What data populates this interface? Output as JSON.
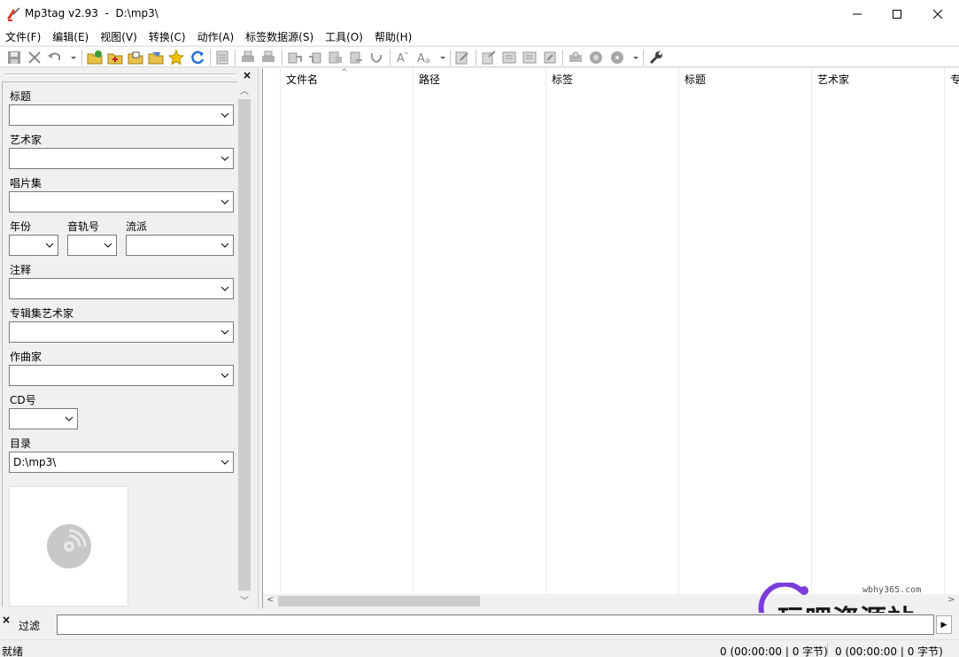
{
  "window": {
    "title": "Mp3tag v2.93  -  D:\\mp3\\",
    "minimize_icon": "minimize-icon",
    "maximize_icon": "maximize-icon",
    "close_icon": "close-icon"
  },
  "menu": [
    "文件(F)",
    "编辑(E)",
    "视图(V)",
    "转换(C)",
    "动作(A)",
    "标签数据源(S)",
    "工具(O)",
    "帮助(H)"
  ],
  "toolbar": {
    "icons": [
      "save-icon",
      "remove-tag-icon",
      "undo-icon",
      "dropdown-icon",
      "change-directory-icon",
      "add-directory-icon",
      "open-folder-icon",
      "folder-playlist-icon",
      "favorite-star-icon",
      "refresh-icon",
      "select-all-icon",
      "print-icon",
      "print-preview-icon",
      "tag-filename-icon",
      "filename-tag-icon",
      "text-tag-icon",
      "tag-tag-icon",
      "autonumber-icon",
      "case-conversion-icon",
      "text-format-icon",
      "edit-icon",
      "export-icon",
      "import-icon",
      "list-icon",
      "quick-action-icon",
      "freedb-icon",
      "web-source-icon",
      "discogs-icon",
      "options-wrench-icon"
    ]
  },
  "tag_panel": {
    "close_glyph": "×",
    "fields": {
      "title": {
        "label": "标题",
        "value": ""
      },
      "artist": {
        "label": "艺术家",
        "value": ""
      },
      "album": {
        "label": "唱片集",
        "value": ""
      },
      "year": {
        "label": "年份",
        "value": ""
      },
      "track": {
        "label": "音轨号",
        "value": ""
      },
      "genre": {
        "label": "流派",
        "value": ""
      },
      "comment": {
        "label": "注释",
        "value": ""
      },
      "album_artist": {
        "label": "专辑集艺术家",
        "value": ""
      },
      "composer": {
        "label": "作曲家",
        "value": ""
      },
      "disc": {
        "label": "CD号",
        "value": ""
      },
      "directory": {
        "label": "目录",
        "value": "D:\\mp3\\"
      }
    },
    "cover_icon": "cd-disc-icon"
  },
  "file_list": {
    "columns": [
      "文件名",
      "路径",
      "标签",
      "标题",
      "艺术家",
      "专"
    ],
    "sort_indicator": "^"
  },
  "filter": {
    "close_glyph": "×",
    "label": "过滤",
    "value": "",
    "go_glyph": "▶"
  },
  "statusbar": {
    "status": "就绪",
    "selected": "0 (00:00:00 | 0 字节)",
    "total": "0 (00:00:00 | 0 字节)"
  },
  "watermark": {
    "url": "wbhy365.com",
    "text": "玩吧资源站"
  }
}
